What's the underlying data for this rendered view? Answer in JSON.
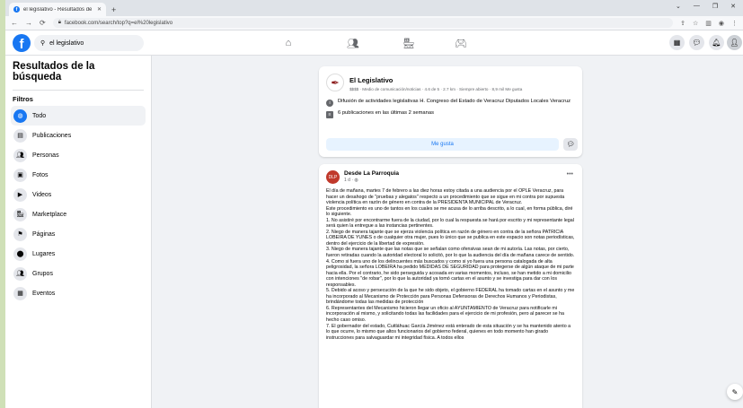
{
  "browser": {
    "tab_title": "el legislativo - Resultados de bú",
    "tab_close": "✕",
    "new_tab": "+",
    "window_controls": [
      "⌄",
      "—",
      "❐",
      "✕"
    ],
    "url": "facebook.com/search/top?q=el%20legislativo",
    "nav": [
      "←",
      "→",
      "⟳"
    ]
  },
  "fb": {
    "search_placeholder": "el legislativo",
    "logo": "f"
  },
  "sidebar": {
    "title": "Resultados de la búsqueda",
    "filters_label": "Filtros",
    "items": [
      {
        "label": "Todo",
        "icon": "globe-icon"
      },
      {
        "label": "Publicaciones",
        "icon": "posts-icon"
      },
      {
        "label": "Personas",
        "icon": "people-icon"
      },
      {
        "label": "Fotos",
        "icon": "photo-icon"
      },
      {
        "label": "Videos",
        "icon": "video-icon"
      },
      {
        "label": "Marketplace",
        "icon": "marketplace-icon"
      },
      {
        "label": "Páginas",
        "icon": "flag-icon"
      },
      {
        "label": "Lugares",
        "icon": "pin-icon"
      },
      {
        "label": "Grupos",
        "icon": "groups-icon"
      },
      {
        "label": "Eventos",
        "icon": "calendar-icon"
      }
    ]
  },
  "page_result": {
    "name": "El Legislativo",
    "meta": "$$$$ · Medio de comunicación/noticias · 4.6 de 5 · 2.7 km · Siempre abierto · 8,9 mil Me gusta",
    "description": "Difusión de actividades legislativas H. Congreso del Estado de Veracruz Diputados Locales Veracruz",
    "posts_info": "6 publicaciones en las últimas 2 semanas",
    "like_label": "Me gusta"
  },
  "post": {
    "author": "Desde La Parroquia",
    "time": "1 d · ◍",
    "paragraphs": [
      "El día de mañana, martes 7 de febrero a las diez horas estoy citada a una audiencia por el OPLE Veracruz, para hacer un desahogo de \"pruebas y alegatos\" respecto a un procedimiento que se sigue en mi contra por supuesta violencia política en razón de género en contra de la PRESIDENTA MUNICIPAL de Veracruz.",
      "Este procedimiento es uno de tantos en los cuales se me acusa de lo arriba descrito, a lo cual, en forma pública, diré lo siguiente.",
      "1. No asistiré por encontrarme fuera de la ciudad, por lo cual la respuesta se hará por escrito y mi representante legal será quien la entregue a las instancias pertinentes.",
      "2. Niego de manera tajante que se ejerza violencia política en razón de género en contra de la señora PATRICIA LOBEIRA DE YUNES o de cualquier otra mujer, pues lo único que se publica en este espacio son notas periodísticas, dentro del ejercicio de la libertad de expresión.",
      "3. Niego de manera tajante que las notas que se señalan como ofensivas sean de mi autoría. Las notas, por cierto, fueron retiradas cuando la autoridad electoral lo solicitó, por lo que la audiencia del día de mañana carece de sentido.",
      "4. Como si fuera uno de los delincuentes más buscados y como si yo fuera una persona catalogada de alta peligrosidad, la señora LOBEIRA ha pedido MEDIDAS DE SEGURIDAD para protegerse de algún ataque de mi parte hacia ella. Por el contrario, he sido perseguida y acosada en varias momentos, incluso, se han metido a mi domicilio con intenciones \"de robar\", por lo que la autoridad ya tomó cartas en el asunto y se investiga para dar con los responsables.",
      "5. Debido al acoso y persecución de la que he sido objeto, el gobierno FEDERAL ha tomado cartas en el asunto y me ha incorporado al Mecanismo de Protección para Personas Defensoras de Derechos Humanos y Periodistas, brindándome todas las medidas de protección",
      "6. Representantes del Mecanismo hicieron llegar un oficio al AYUNTAMIENTO de Veracruz para notificarle mi incorporación al mismo, y solicitando todas las facilidades para el ejercicio de mi profesión, pero al parecer se ha hecho caso omiso.",
      "7. El gobernador del estado, Cuitláhuac García Jiménez está enterado de esta situación y se ha mantenido atento a lo que ocurre, lo mismo que altos funcionarios del gobierno federal, quienes en todo momento han girado instrucciones para salvaguardar mi integridad física. A todos ellos"
    ]
  }
}
